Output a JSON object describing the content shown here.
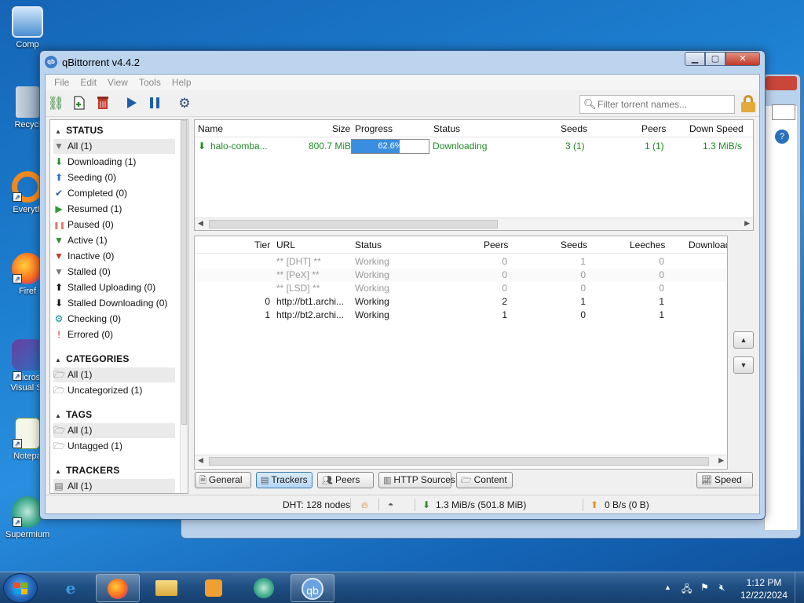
{
  "desktop": {
    "icons": [
      {
        "label": "Comp"
      },
      {
        "label": "Recycl"
      },
      {
        "label": "Everyth"
      },
      {
        "label": "Firef"
      },
      {
        "label": "Micros Visual St"
      },
      {
        "label": "Notepa"
      },
      {
        "label": "Supermium"
      }
    ]
  },
  "window": {
    "title": "qBittorrent v4.4.2",
    "minimize": "▁",
    "maximize": "▢",
    "close": "✕"
  },
  "menu": [
    "File",
    "Edit",
    "View",
    "Tools",
    "Help"
  ],
  "search": {
    "placeholder": "Filter torrent names..."
  },
  "sidebar": {
    "status_header": "STATUS",
    "status_items": [
      {
        "label": "All (1)",
        "icon": "funnel-icon",
        "glyph": "▼",
        "color": "#777777"
      },
      {
        "label": "Downloading (1)",
        "icon": "download-arrow-icon",
        "glyph": "⬇",
        "color": "#2e8b2e"
      },
      {
        "label": "Seeding (0)",
        "icon": "upload-arrow-icon",
        "glyph": "⬆",
        "color": "#2f6fd0"
      },
      {
        "label": "Completed (0)",
        "icon": "checkmark-icon",
        "glyph": "✔",
        "color": "#3a5f8f"
      },
      {
        "label": "Resumed (1)",
        "icon": "play-icon",
        "glyph": "▶",
        "color": "#2e9b2e"
      },
      {
        "label": "Paused (0)",
        "icon": "pause-icon",
        "glyph": "❚❚",
        "color": "#e07a6a"
      },
      {
        "label": "Active (1)",
        "icon": "funnel-green-icon",
        "glyph": "▼",
        "color": "#2e8b2e"
      },
      {
        "label": "Inactive (0)",
        "icon": "funnel-red-icon",
        "glyph": "▼",
        "color": "#c0392b"
      },
      {
        "label": "Stalled (0)",
        "icon": "funnel-gray-icon",
        "glyph": "▼",
        "color": "#777777"
      },
      {
        "label": "Stalled Uploading (0)",
        "icon": "up-arrow-black-icon",
        "glyph": "⬆",
        "color": "#111111"
      },
      {
        "label": "Stalled Downloading (0)",
        "icon": "down-arrow-black-icon",
        "glyph": "⬇",
        "color": "#111111"
      },
      {
        "label": "Checking (0)",
        "icon": "gear-cycle-icon",
        "glyph": "⚙",
        "color": "#138c8c"
      },
      {
        "label": "Errored (0)",
        "icon": "exclamation-icon",
        "glyph": "!",
        "color": "#d01c1c"
      }
    ],
    "categories_header": "CATEGORIES",
    "categories": [
      {
        "label": "All (1)"
      },
      {
        "label": "Uncategorized (1)"
      }
    ],
    "tags_header": "TAGS",
    "tags": [
      {
        "label": "All (1)"
      },
      {
        "label": "Untagged (1)"
      }
    ],
    "trackers_header": "TRACKERS",
    "trackers": [
      {
        "label": "All (1)"
      }
    ]
  },
  "torrents": {
    "columns": [
      "Name",
      "Size",
      "Progress",
      "Status",
      "Seeds",
      "Peers",
      "Down Speed"
    ],
    "rows": [
      {
        "name": "halo-comba...",
        "size": "800.7 MiB",
        "progress_text": "62.6%",
        "progress": 0.626,
        "status": "Downloading",
        "seeds": "3 (1)",
        "peers": "1 (1)",
        "down_speed": "1.3 MiB/s"
      }
    ]
  },
  "trackers": {
    "columns": [
      "Tier",
      "URL",
      "Status",
      "Peers",
      "Seeds",
      "Leeches",
      "Download"
    ],
    "rows": [
      {
        "tier": "",
        "url": "** [DHT] **",
        "status": "Working",
        "peers": "0",
        "seeds": "1",
        "leeches": "0",
        "muted": true
      },
      {
        "tier": "",
        "url": "** [PeX] **",
        "status": "Working",
        "peers": "0",
        "seeds": "0",
        "leeches": "0",
        "muted": true
      },
      {
        "tier": "",
        "url": "** [LSD] **",
        "status": "Working",
        "peers": "0",
        "seeds": "0",
        "leeches": "0",
        "muted": true
      },
      {
        "tier": "0",
        "url": "http://bt1.archi...",
        "status": "Working",
        "peers": "2",
        "seeds": "1",
        "leeches": "1",
        "muted": false
      },
      {
        "tier": "1",
        "url": "http://bt2.archi...",
        "status": "Working",
        "peers": "1",
        "seeds": "0",
        "leeches": "1",
        "muted": false
      }
    ]
  },
  "tabs": [
    "General",
    "Trackers",
    "Peers",
    "HTTP Sources",
    "Content"
  ],
  "speed_button": "Speed",
  "statusbar": {
    "dht": "DHT: 128 nodes",
    "download": "1.3 MiB/s (501.8 MiB)",
    "upload": "0 B/s (0 B)"
  },
  "taskbar": {
    "time": "1:12 PM",
    "date": "12/22/2024"
  },
  "colors": {
    "accent": "#3a8ee0",
    "downloading": "#1f8a24"
  }
}
